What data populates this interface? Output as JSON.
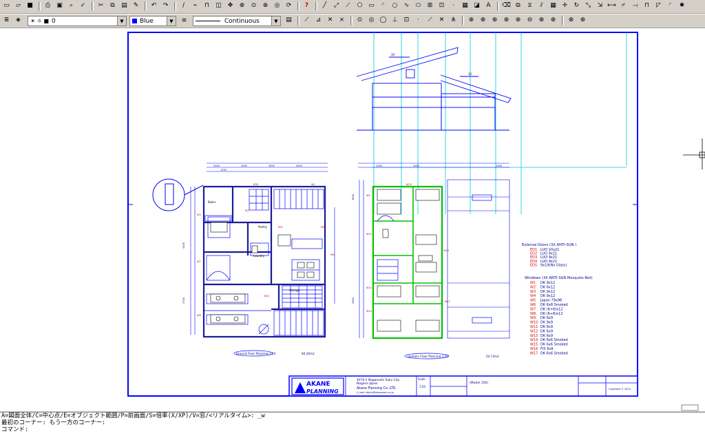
{
  "toolbar": {
    "layer_value": "0",
    "color_value": "Blue",
    "linetype_value": "Continuous"
  },
  "drawing": {
    "ground_floor_title": "Ground Floor Planning 1:50",
    "ground_floor_area": "84.30m2",
    "upstairs_title": "Upstairs Floor Planning 1:50",
    "upstairs_area": "54.73m2",
    "rooms": {
      "pantry": "Pantry",
      "laundry": "Laundry",
      "storage": "Storage",
      "boiler": "Boiler"
    },
    "legend": {
      "doors_title": "External Doors (3X ANTI-SUN )",
      "doors": [
        {
          "code": "ED1",
          "text": "LUO 10x21"
        },
        {
          "code": "ED2",
          "text": "LUO 9x21"
        },
        {
          "code": "ED3",
          "text": "LUO 9x21"
        },
        {
          "code": "ED4",
          "text": "LUO 9x21"
        },
        {
          "code": "ED5",
          "text": "9x19(No Glass)"
        }
      ],
      "windows_title": "Windows (3X ANTI-SUN Mosquito-Net)",
      "windows": [
        {
          "code": "W1",
          "text": "DK 9x12"
        },
        {
          "code": "W2",
          "text": "DK 6x12"
        },
        {
          "code": "W3",
          "text": "DK 9x12"
        },
        {
          "code": "W4",
          "text": "DK 9x12"
        },
        {
          "code": "W5",
          "text": "Japan 79x98"
        },
        {
          "code": "W6",
          "text": "DK 6x8 Smoked"
        },
        {
          "code": "W7",
          "text": "DK (6+8)x12"
        },
        {
          "code": "W8",
          "text": "DK (6+8)x12"
        },
        {
          "code": "W9",
          "text": "DK 6x9"
        },
        {
          "code": "W10",
          "text": "DK 9x9"
        },
        {
          "code": "W11",
          "text": "DK 6x9"
        },
        {
          "code": "W12",
          "text": "DK 6x9"
        },
        {
          "code": "W13",
          "text": "DK 6x9"
        },
        {
          "code": "W14",
          "text": "DK 6x6 Smoked"
        },
        {
          "code": "W15",
          "text": "DK 6x6 Smoked"
        },
        {
          "code": "W16",
          "text": "FIX 6x6"
        },
        {
          "code": "W17",
          "text": "DK 6x6 Smoked"
        }
      ]
    },
    "title_block": {
      "logo_top": "AKANE",
      "logo_bottom": "PLANNING",
      "address": "4074-1 Naganoshi Saku City",
      "address2": "Nagano Japan",
      "company": "Akane Planning Co.,LTD.",
      "contact": "E_mail: akane@akaneplan.co.jp",
      "scale_label": "Scale",
      "scale": "1:50",
      "model": "(Model 156)",
      "copyright": "Copyright © 2014,"
    }
  },
  "command": {
    "line1": "A=図面全体/C=中心点/E=オブジェクト範囲/P=前画面/S=倍率(X/XP)/V=窓/<リアルタイム>: _w",
    "line2": "最初のコーナー: もう一方のコーナー:",
    "line3": "コマンド:"
  }
}
